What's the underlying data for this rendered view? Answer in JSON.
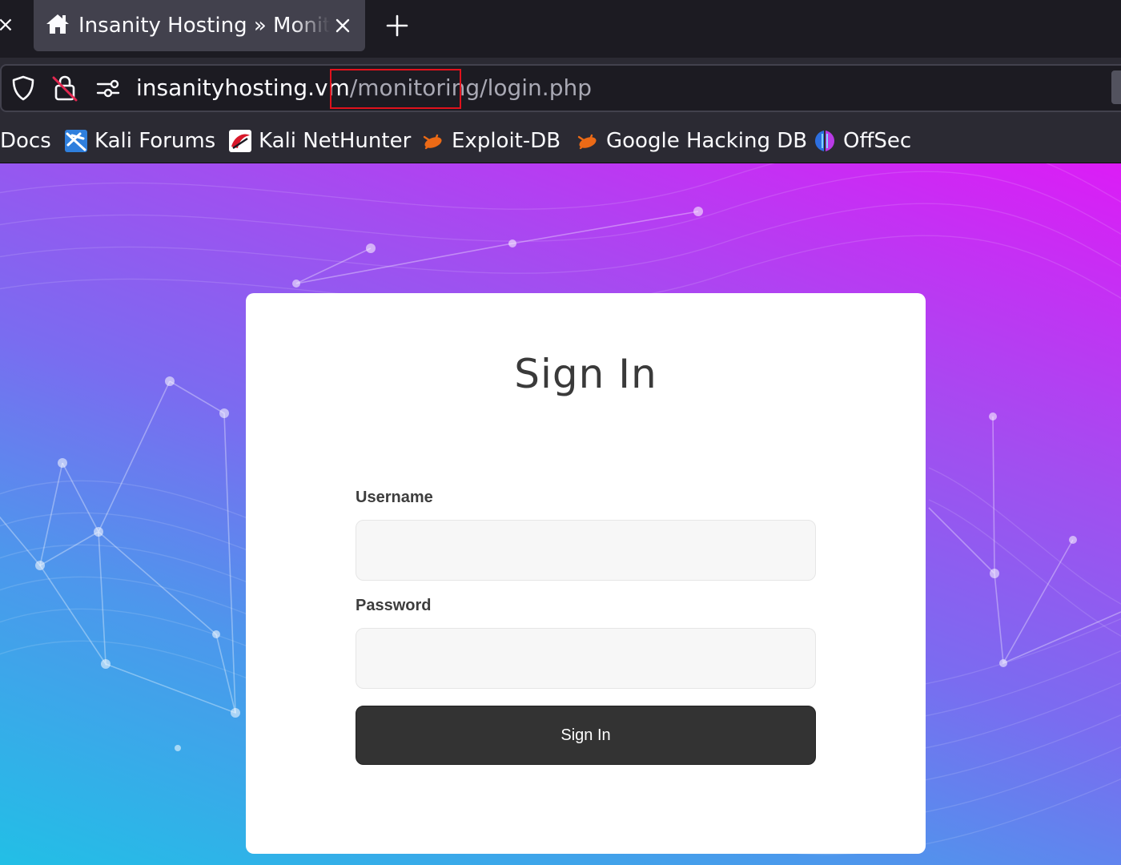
{
  "browser": {
    "tab": {
      "title": "Insanity Hosting » Monitoring",
      "home_icon": "home-icon",
      "close_icon": "close-icon"
    },
    "new_tab_icon": "plus-icon",
    "url": {
      "host": "insanityhosting.vm",
      "sep1": "/",
      "path": "monitoring",
      "sep2": "/",
      "file": "login.php"
    },
    "url_icons": [
      "shield-icon",
      "insecure-lock-icon",
      "permissions-icon"
    ],
    "bookmarks": [
      {
        "label": "Docs",
        "icon": ""
      },
      {
        "label": "Kali Forums",
        "icon": "kali-dragon-icon"
      },
      {
        "label": "Kali NetHunter",
        "icon": "nethunter-icon"
      },
      {
        "label": "Exploit-DB",
        "icon": "exploitdb-icon"
      },
      {
        "label": "Google Hacking DB",
        "icon": "exploitdb-icon"
      },
      {
        "label": "OffSec",
        "icon": "offsec-icon"
      }
    ]
  },
  "login": {
    "title": "Sign In",
    "username_label": "Username",
    "username_value": "",
    "password_label": "Password",
    "password_value": "",
    "submit_label": "Sign In"
  },
  "colors": {
    "gradient_top_right": "#dc1cf6",
    "gradient_bottom_left": "#22bfe6",
    "button_bg": "#333333",
    "highlight_box": "#e0121c"
  }
}
